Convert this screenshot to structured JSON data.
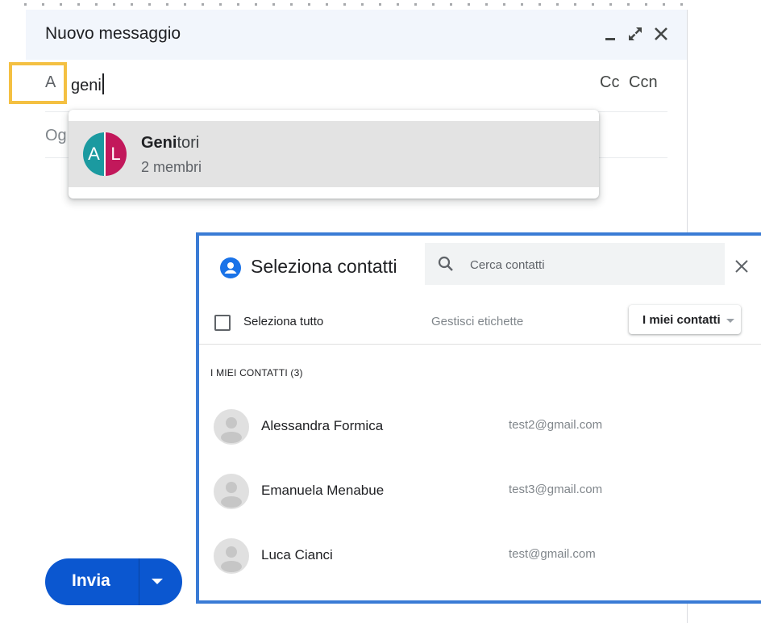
{
  "compose": {
    "title": "Nuovo messaggio",
    "to_label": "A",
    "to_value": "geni",
    "cc": "Cc",
    "ccn": "Ccn",
    "subject_placeholder": "Og"
  },
  "suggestion": {
    "avatar_letters": [
      "A",
      "L"
    ],
    "name_match": "Geni",
    "name_rest": "tori",
    "members": "2 membri"
  },
  "send": {
    "label": "Invia"
  },
  "picker": {
    "title": "Seleziona contatti",
    "search_placeholder": "Cerca contatti",
    "select_all": "Seleziona tutto",
    "manage_labels": "Gestisci etichette",
    "group_dropdown": "I miei contatti",
    "section": "I MIEI CONTATTI (3)",
    "contacts": [
      {
        "name": "Alessandra Formica",
        "email": "test2@gmail.com"
      },
      {
        "name": "Emanuela Menabue",
        "email": "test3@gmail.com"
      },
      {
        "name": "Luca Cianci",
        "email": "test@gmail.com"
      }
    ]
  },
  "colors": {
    "highlight_to": "#f4c042",
    "picker_border": "#3a7bd5",
    "send_button": "#0b57d0",
    "avatar_a": "#1b9aa0",
    "avatar_b": "#c2185b"
  }
}
